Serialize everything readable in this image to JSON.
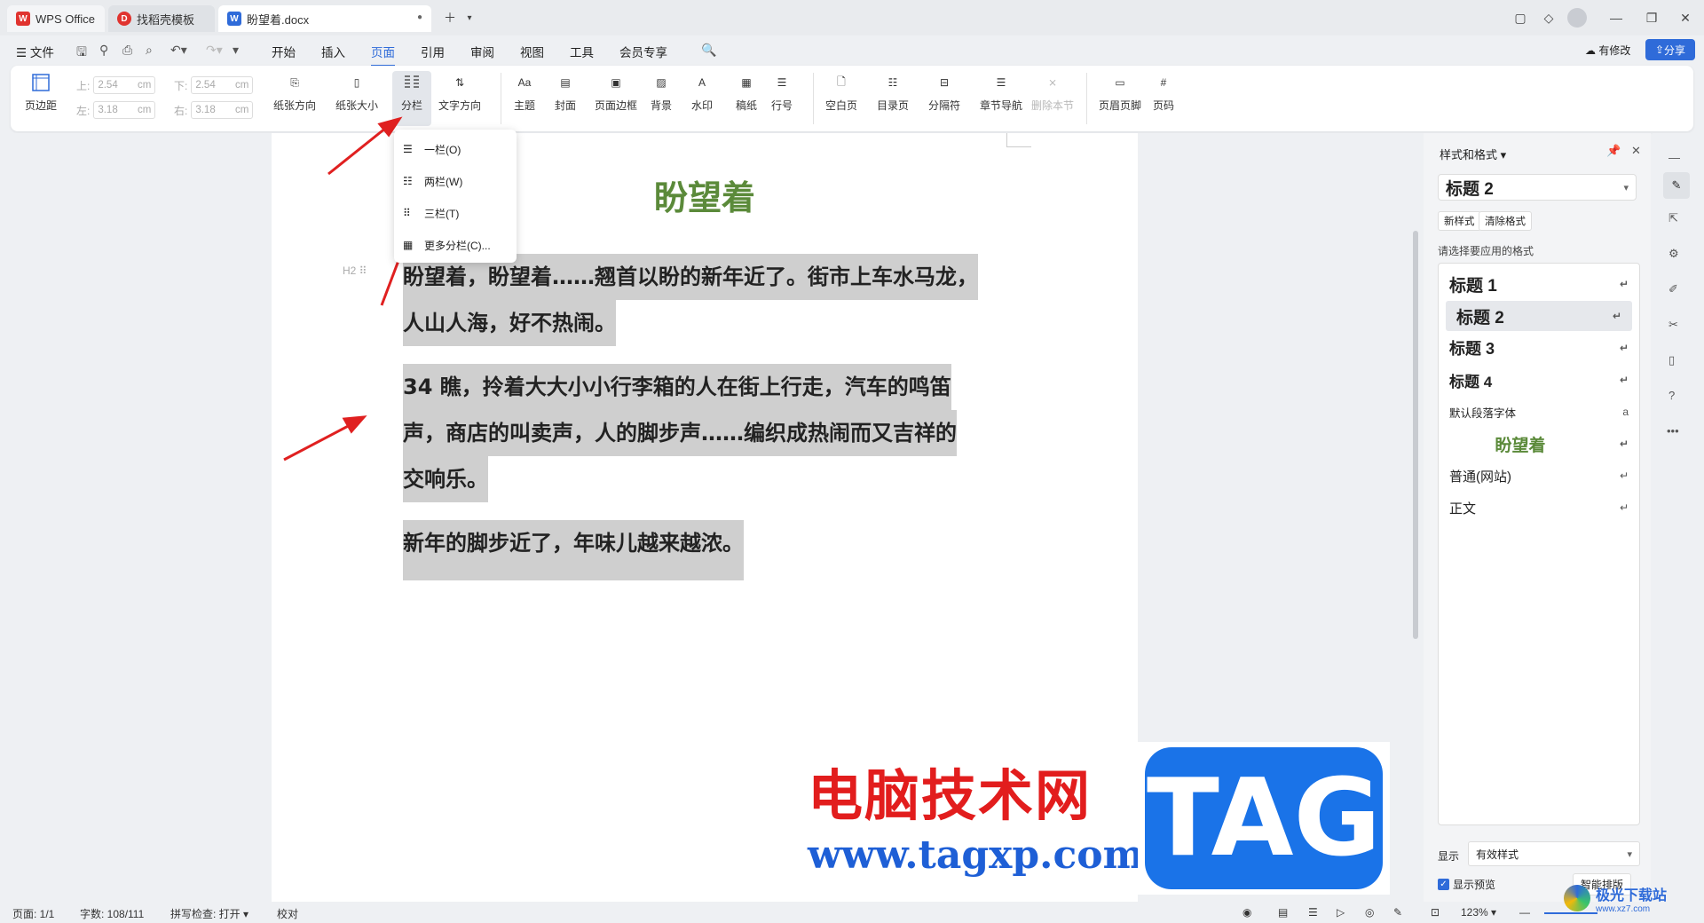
{
  "titlebar": {
    "tabs": [
      {
        "label": "WPS Office",
        "icon": "wps-logo-icon",
        "color": "#e0332f"
      },
      {
        "label": "找稻壳模板",
        "icon": "docer-logo-icon",
        "color": "#e0332f"
      },
      {
        "label": "盼望着.docx",
        "icon": "word-doc-icon",
        "color": "#2f6bd9"
      }
    ]
  },
  "menubar": {
    "file": "文件",
    "items": [
      "开始",
      "插入",
      "页面",
      "引用",
      "审阅",
      "视图",
      "工具",
      "会员专享"
    ],
    "active": "页面",
    "modified": "有修改",
    "share": "分享"
  },
  "ribbon": {
    "margins_label": "页边距",
    "top_label": "上:",
    "top_value": "2.54",
    "bottom_label": "下:",
    "bottom_value": "2.54",
    "left_label": "左:",
    "left_value": "3.18",
    "right_label": "右:",
    "right_value": "3.18",
    "unit": "cm",
    "buttons": [
      "纸张方向",
      "纸张大小",
      "分栏",
      "文字方向",
      "主题",
      "封面",
      "页面边框",
      "背景",
      "水印",
      "稿纸",
      "行号",
      "空白页",
      "目录页",
      "分隔符",
      "章节导航",
      "删除本节",
      "页眉页脚",
      "页码"
    ]
  },
  "columns_menu": {
    "items": [
      "一栏(O)",
      "两栏(W)",
      "三栏(T)",
      "更多分栏(C)..."
    ]
  },
  "document": {
    "title": "盼望着",
    "heading_marker": "H2",
    "paragraphs": [
      "盼望着，盼望着……翘首以盼的新年近了。街市上车水马龙，",
      "人山人海，好不热闹。",
      "34 瞧，拎着大大小小行李箱的人在街上行走，汽车的鸣笛",
      "声，商店的叫卖声，人的脚步声……编织成热闹而又吉祥的",
      "交响乐。",
      "新年的脚步近了，年味儿越来越浓。"
    ],
    "title_color": "#5b8a3a",
    "highlight_color": "#cfcfcf"
  },
  "watermark": {
    "cn_text": "电脑技术网",
    "url": "www.tagxp.com",
    "logo": "TAG",
    "cn_color": "#e21d1d",
    "url_color": "#1e5fd6",
    "logo_bg": "#1a73e8"
  },
  "panel": {
    "title": "样式和格式",
    "current_style": "标题 2",
    "new_style": "新样式",
    "clear_format": "清除格式",
    "choose_label": "请选择要应用的格式",
    "styles": [
      "标题 1",
      "标题 2",
      "标题 3",
      "标题 4",
      "默认段落字体",
      "盼望着",
      "普通(网站)",
      "正文"
    ],
    "show_label": "显示",
    "show_value": "有效样式",
    "preview_label": "显示预览",
    "smart_layout": "智能排版"
  },
  "statusbar": {
    "page": "页面: 1/1",
    "words": "字数: 108/111",
    "spell": "拼写检查: 打开",
    "proof": "校对",
    "zoom": "123%"
  },
  "badge": "极光下载站",
  "badge_url": "www.xz7.com"
}
